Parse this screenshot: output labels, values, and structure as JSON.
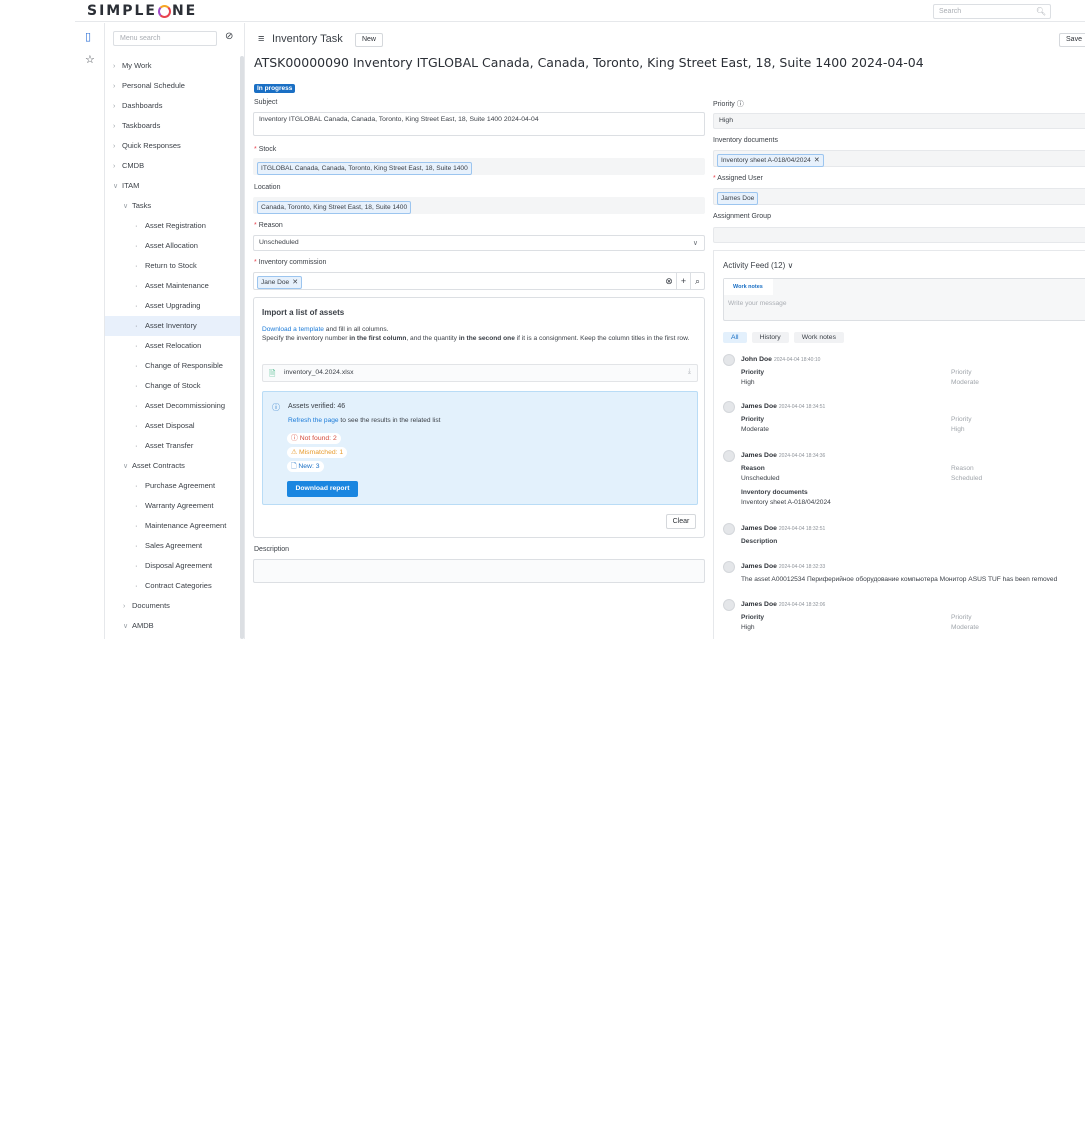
{
  "header": {
    "logo": "SIMPLEONE",
    "search_placeholder": "Search"
  },
  "sidebar": {
    "search_placeholder": "Menu search",
    "items": [
      {
        "label": "My Work",
        "level": 0,
        "expanded": false
      },
      {
        "label": "Personal Schedule",
        "level": 0,
        "expanded": false
      },
      {
        "label": "Dashboards",
        "level": 0,
        "expanded": false
      },
      {
        "label": "Taskboards",
        "level": 0,
        "expanded": false
      },
      {
        "label": "Quick Responses",
        "level": 0,
        "expanded": false
      },
      {
        "label": "CMDB",
        "level": 0,
        "expanded": false
      },
      {
        "label": "ITAM",
        "level": 0,
        "expanded": true
      },
      {
        "label": "Tasks",
        "level": 1,
        "expanded": true
      },
      {
        "label": "Asset Registration",
        "level": 2
      },
      {
        "label": "Asset Allocation",
        "level": 2
      },
      {
        "label": "Return to Stock",
        "level": 2
      },
      {
        "label": "Asset Maintenance",
        "level": 2
      },
      {
        "label": "Asset Upgrading",
        "level": 2
      },
      {
        "label": "Asset Inventory",
        "level": 2,
        "active": true
      },
      {
        "label": "Asset Relocation",
        "level": 2
      },
      {
        "label": "Change of Responsible",
        "level": 2
      },
      {
        "label": "Change of Stock",
        "level": 2
      },
      {
        "label": "Asset Decommissioning",
        "level": 2
      },
      {
        "label": "Asset Disposal",
        "level": 2
      },
      {
        "label": "Asset Transfer",
        "level": 2
      },
      {
        "label": "Asset Contracts",
        "level": 1,
        "expanded": true
      },
      {
        "label": "Purchase Agreement",
        "level": 2
      },
      {
        "label": "Warranty Agreement",
        "level": 2
      },
      {
        "label": "Maintenance Agreement",
        "level": 2
      },
      {
        "label": "Sales Agreement",
        "level": 2
      },
      {
        "label": "Disposal Agreement",
        "level": 2
      },
      {
        "label": "Contract Categories",
        "level": 2
      },
      {
        "label": "Documents",
        "level": 1,
        "expanded": false
      },
      {
        "label": "AMDB",
        "level": 1,
        "expanded": true
      }
    ]
  },
  "form": {
    "title": "Inventory Task",
    "new_label": "New",
    "save_label": "Save",
    "record_title": "ATSK00000090 Inventory ITGLOBAL Canada, Canada, Toronto, King Street East, 18, Suite 1400 2024-04-04",
    "state": "In progress",
    "fields": {
      "subject": {
        "label": "Subject",
        "value": "Inventory ITGLOBAL Canada, Canada, Toronto, King Street East, 18, Suite 1400 2024-04-04"
      },
      "stock": {
        "label": "Stock",
        "required": "*",
        "value": "ITGLOBAL Canada, Canada, Toronto, King Street East, 18, Suite 1400"
      },
      "location": {
        "label": "Location",
        "value": "Canada, Toronto, King Street East, 18, Suite 1400"
      },
      "reason": {
        "label": "Reason",
        "required": "*",
        "value": "Unscheduled"
      },
      "commission": {
        "label": "Inventory commission",
        "required": "*",
        "value": "Jane Doe"
      },
      "description": {
        "label": "Description",
        "value": ""
      },
      "priority": {
        "label": "Priority",
        "value": "High"
      },
      "inventory_documents": {
        "label": "Inventory documents",
        "value": "Inventory sheet A-018/04/2024"
      },
      "assigned_user": {
        "label": "Assigned User",
        "required": "*",
        "value": "James Doe"
      },
      "assignment_group": {
        "label": "Assignment Group",
        "value": ""
      }
    }
  },
  "import": {
    "title": "Import a list of assets",
    "link_template": "Download a template",
    "help_1": " and fill in all columns.",
    "help_2a": "Specify the inventory number ",
    "help_2b": "in the first column",
    "help_2c": ", and the quantity ",
    "help_2d": "in the second one",
    "help_2e": " if it is a consignment. Keep the column titles in the first row.",
    "file_name": "inventory_04.2024.xlsx",
    "verified": "Assets verified: 46",
    "refresh_link": "Refresh the page",
    "refresh_rest": " to see the results in the related list",
    "not_found": "Not found: 2",
    "mismatched": "Mismatched: 1",
    "new": "New: 3",
    "download_report": "Download report",
    "clear": "Clear"
  },
  "activity": {
    "title": "Activity Feed (12)",
    "composer_tab": "Work notes",
    "composer_placeholder": "Write your message",
    "tabs": [
      "All",
      "History",
      "Work notes"
    ],
    "entries": [
      {
        "author": "John Doe",
        "time": "2024-04-04 18:40:10",
        "changes": [
          {
            "field": "Priority",
            "new": "High",
            "old_field": "Priority",
            "old": "Moderate"
          }
        ]
      },
      {
        "author": "James Doe",
        "time": "2024-04-04 18:34:51",
        "changes": [
          {
            "field": "Priority",
            "new": "Moderate",
            "old_field": "Priority",
            "old": "High"
          }
        ]
      },
      {
        "author": "James Doe",
        "time": "2024-04-04 18:34:36",
        "changes": [
          {
            "field": "Reason",
            "new": "Unscheduled",
            "old_field": "Reason",
            "old": "Scheduled"
          },
          {
            "field": "Inventory documents",
            "new": "Inventory sheet A-018/04/2024"
          }
        ]
      },
      {
        "author": "James Doe",
        "time": "2024-04-04 18:32:51",
        "changes": [
          {
            "field": "Description"
          }
        ]
      },
      {
        "author": "James Doe",
        "time": "2024-04-04 18:32:33",
        "message": "The asset A00012534 Периферийное оборудование компьютера Монитор ASUS TUF has been removed"
      },
      {
        "author": "James Doe",
        "time": "2024-04-04 18:32:06",
        "changes": [
          {
            "field": "Priority",
            "new": "High",
            "old_field": "Priority",
            "old": "Moderate"
          }
        ]
      }
    ]
  }
}
